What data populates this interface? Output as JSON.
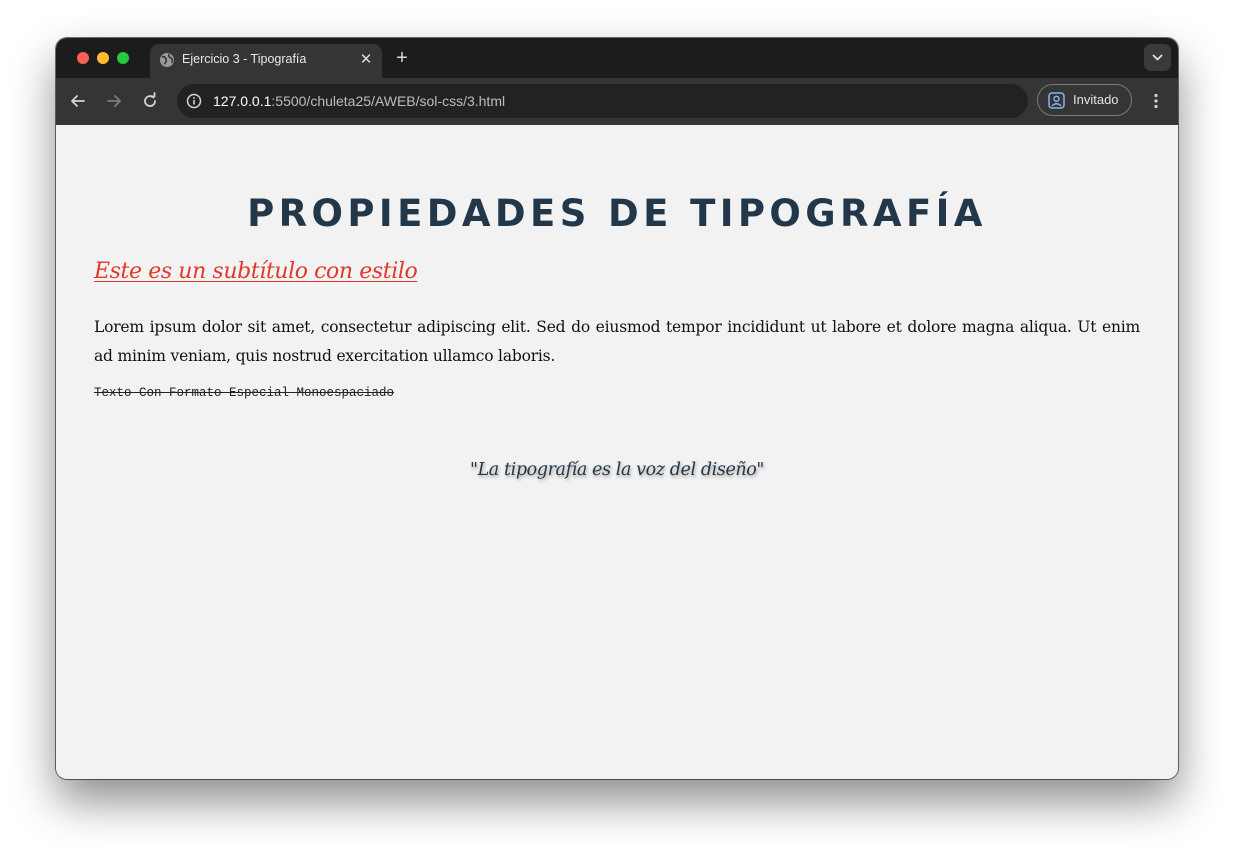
{
  "browser": {
    "tab": {
      "title": "Ejercicio 3 - Tipografía",
      "favicon": "globe-icon",
      "close_icon": "close-icon"
    },
    "new_tab_icon": "plus-icon",
    "tab_search_icon": "chevron-down-icon",
    "toolbar": {
      "back_icon": "arrow-left-icon",
      "forward_icon": "arrow-right-icon",
      "reload_icon": "reload-icon",
      "site_info_icon": "info-icon",
      "url_host": "127.0.0.1",
      "url_rest": ":5500/chuleta25/AWEB/sol-css/3.html",
      "profile_label": "Invitado",
      "profile_icon": "guest-profile-icon",
      "menu_icon": "kebab-menu-icon"
    }
  },
  "page": {
    "heading": "PROPIEDADES DE TIPOGRAFÍA",
    "subtitle": "Este es un subtítulo con estilo",
    "paragraph": "Lorem ipsum dolor sit amet, consectetur adipiscing elit. Sed do eiusmod tempor incididunt ut labore et dolore magna aliqua. Ut enim ad minim veniam, quis nostrud exercitation ullamco laboris.",
    "mono_text": "Texto Con Formato Especial Monoespaciado",
    "quote": "\"La tipografía es la voz del diseño\""
  },
  "colors": {
    "heading": "#22384a",
    "subtitle": "#e0392c",
    "page_background": "#f2f2f2"
  }
}
